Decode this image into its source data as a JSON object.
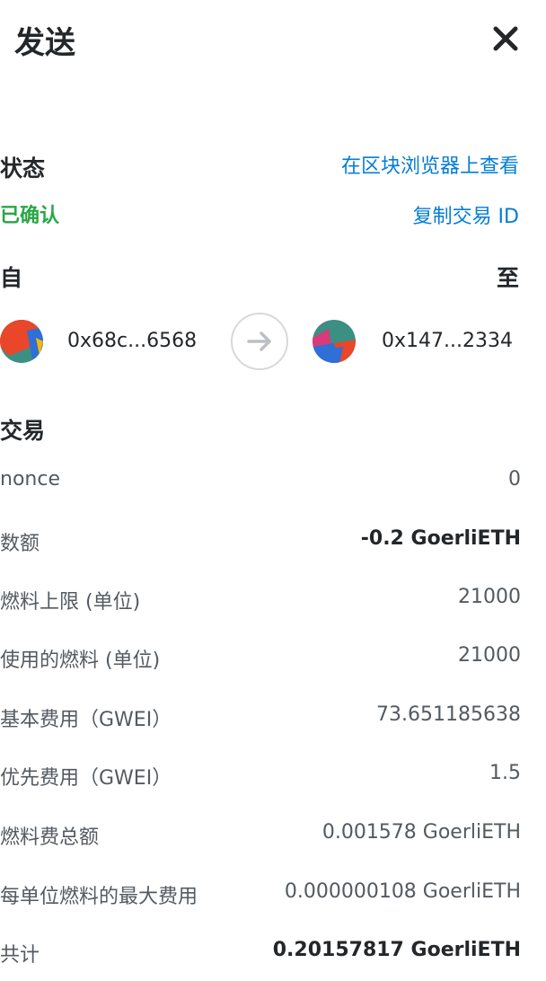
{
  "header": {
    "title": "发送",
    "close_icon": "close-icon"
  },
  "status": {
    "label": "状态",
    "value": "已确认",
    "explorer_link": "在区块浏览器上查看",
    "copy_link": "复制交易 ID",
    "value_color": "#28a745",
    "link_color": "#037dd6"
  },
  "parties": {
    "from_label": "自",
    "to_label": "至",
    "from_address": "0x68c...6568",
    "to_address": "0x147...2334",
    "arrow_icon": "arrow-right-icon"
  },
  "transaction": {
    "title": "交易",
    "rows": [
      {
        "label": "nonce",
        "value": "0"
      },
      {
        "label": "数额",
        "value": "-0.2 GoerliETH"
      },
      {
        "label": "燃料上限 (单位)",
        "value": "21000"
      },
      {
        "label": "使用的燃料 (单位)",
        "value": "21000"
      },
      {
        "label": "基本费用（GWEI）",
        "value": "73.651185638"
      },
      {
        "label": "优先费用（GWEI）",
        "value": "1.5"
      },
      {
        "label": "燃料费总额",
        "value": "0.001578 GoerliETH"
      },
      {
        "label": "每单位燃料的最大费用",
        "value": "0.000000108 GoerliETH"
      },
      {
        "label": "共计",
        "value": "0.20157817 GoerliETH"
      }
    ]
  }
}
